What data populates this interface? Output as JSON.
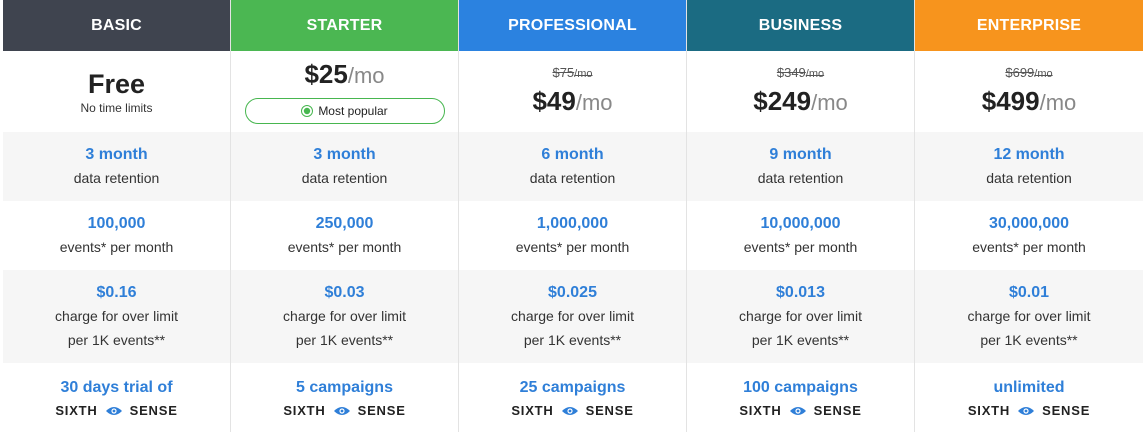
{
  "plans": [
    {
      "name": "BASIC",
      "color": "#3f444f",
      "price": {
        "label": "Free",
        "sub": "No time limits"
      },
      "retention": {
        "value": "3 month",
        "label": "data retention"
      },
      "events": {
        "value": "100,000",
        "label": "events* per month"
      },
      "overage": {
        "value": "$0.16",
        "line1": "charge for over limit",
        "line2": "per 1K events**"
      },
      "campaigns": {
        "value": "30 days trial of"
      },
      "brand": {
        "left": "SIXTH",
        "right": "SENSE",
        "icon": "eye-icon"
      }
    },
    {
      "name": "STARTER",
      "color": "#4bb752",
      "price": {
        "current": "$25",
        "per": "/mo",
        "badge": "Most popular",
        "badge_icon": "star-icon"
      },
      "retention": {
        "value": "3 month",
        "label": "data retention"
      },
      "events": {
        "value": "250,000",
        "label": "events* per month"
      },
      "overage": {
        "value": "$0.03",
        "line1": "charge for over limit",
        "line2": "per 1K events**"
      },
      "campaigns": {
        "value": "5 campaigns"
      },
      "brand": {
        "left": "SIXTH",
        "right": "SENSE",
        "icon": "eye-icon"
      }
    },
    {
      "name": "PROFESSIONAL",
      "color": "#2b82e0",
      "price": {
        "old": "$75",
        "old_per": "/mo",
        "current": "$49",
        "per": "/mo"
      },
      "retention": {
        "value": "6 month",
        "label": "data retention"
      },
      "events": {
        "value": "1,000,000",
        "label": "events* per month"
      },
      "overage": {
        "value": "$0.025",
        "line1": "charge for over limit",
        "line2": "per 1K events**"
      },
      "campaigns": {
        "value": "25 campaigns"
      },
      "brand": {
        "left": "SIXTH",
        "right": "SENSE",
        "icon": "eye-icon"
      }
    },
    {
      "name": "BUSINESS",
      "color": "#1b6b82",
      "price": {
        "old": "$349",
        "old_per": "/mo",
        "current": "$249",
        "per": "/mo"
      },
      "retention": {
        "value": "9 month",
        "label": "data retention"
      },
      "events": {
        "value": "10,000,000",
        "label": "events* per month"
      },
      "overage": {
        "value": "$0.013",
        "line1": "charge for over limit",
        "line2": "per 1K events**"
      },
      "campaigns": {
        "value": "100 campaigns"
      },
      "brand": {
        "left": "SIXTH",
        "right": "SENSE",
        "icon": "eye-icon"
      }
    },
    {
      "name": "ENTERPRISE",
      "color": "#f7941d",
      "price": {
        "old": "$699",
        "old_per": "/mo",
        "current": "$499",
        "per": "/mo"
      },
      "retention": {
        "value": "12 month",
        "label": "data retention"
      },
      "events": {
        "value": "30,000,000",
        "label": "events* per month"
      },
      "overage": {
        "value": "$0.01",
        "line1": "charge for over limit",
        "line2": "per 1K events**"
      },
      "campaigns": {
        "value": "unlimited"
      },
      "brand": {
        "left": "SIXTH",
        "right": "SENSE",
        "icon": "eye-icon"
      }
    }
  ],
  "accent_color": "#2f7fd8"
}
